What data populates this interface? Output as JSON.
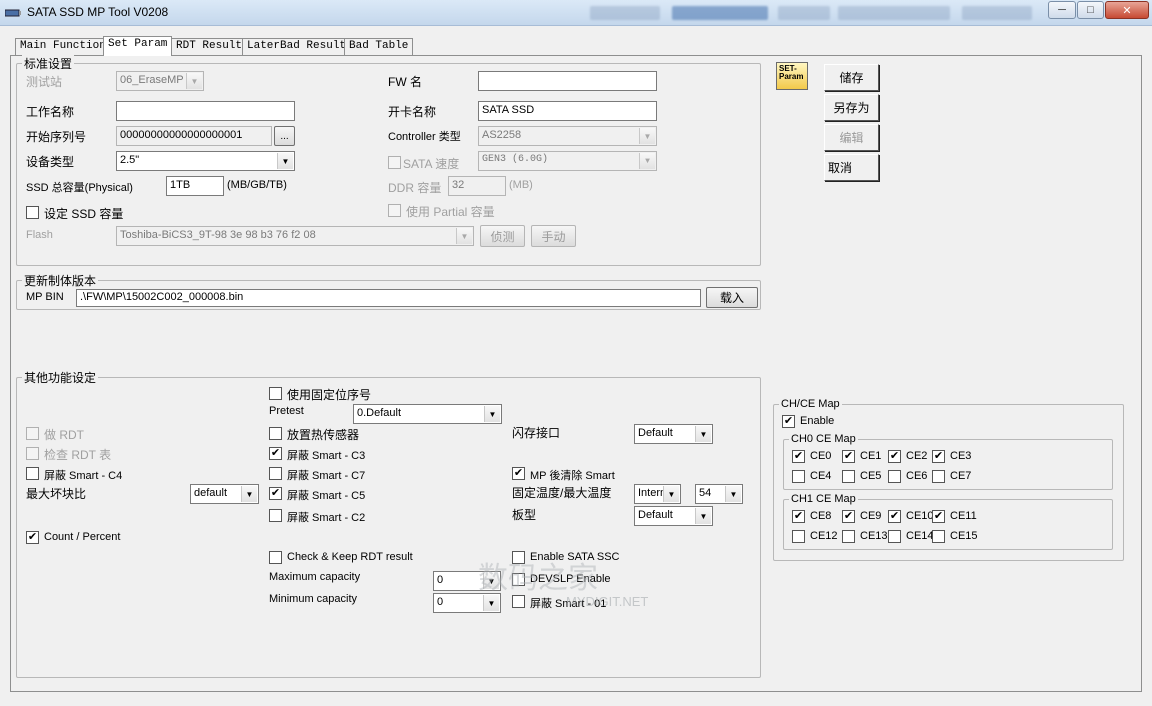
{
  "window": {
    "title": "SATA SSD MP Tool V0208",
    "controls": {
      "minimize": "─",
      "maximize": "□",
      "close": "✕"
    }
  },
  "tabs": [
    {
      "label": "Main Function"
    },
    {
      "label": "Set Param"
    },
    {
      "label": "RDT Result"
    },
    {
      "label": "LaterBad Result"
    },
    {
      "label": "Bad Table"
    }
  ],
  "standard": {
    "group_label": "标准设置",
    "station_label": "测试站",
    "station_value": "06_EraseMP",
    "work_name_label": "工作名称",
    "work_name_value": "",
    "start_serial_label": "开始序列号",
    "start_serial_value": "00000000000000000001",
    "serial_browse": "...",
    "device_type_label": "设备类型",
    "device_type_value": "2.5\"",
    "ssd_capacity_label": "SSD 总容量(Physical)",
    "ssd_capacity_value": "1TB",
    "ssd_capacity_unit": "(MB/GB/TB)",
    "set_ssd_capacity_label": "设定 SSD 容量",
    "flash_label": "Flash",
    "flash_value": "Toshiba-BiCS3_9T-98 3e 98 b3 76 f2 08",
    "detect_button": "侦测",
    "manual_button": "手动",
    "fw_name_label": "FW 名",
    "fw_name_value": "",
    "card_name_label": "开卡名称",
    "card_name_value": "SATA SSD",
    "controller_label": "Controller 类型",
    "controller_value": "AS2258",
    "sata_speed_label": "SATA 速度",
    "sata_speed_value": "GEN3 (6.0G)",
    "ddr_label": "DDR 容量",
    "ddr_value": "32",
    "ddr_unit": "(MB)",
    "partial_label": "使用 Partial 容量"
  },
  "firmware": {
    "group_label": "更新制体版本",
    "mp_bin_label": "MP BIN",
    "mp_bin_value": ".\\FW\\MP\\15002C002_000008.bin",
    "load_button": "载入"
  },
  "side_buttons": {
    "icon_text": "SET-Param",
    "save": "储存",
    "save_as": "另存为",
    "edit": "编辑",
    "cancel": "取消"
  },
  "other": {
    "group_label": "其他功能设定",
    "do_rdt": "做 RDT",
    "check_rdt_table": "检查 RDT 表",
    "mask_smart_c4": "屏蔽 Smart - C4",
    "max_bad_block_label": "最大坏块比",
    "max_bad_block_value": "default",
    "count_percent": "Count / Percent",
    "use_fixed_position": "使用固定位序号",
    "pretest_label": "Pretest",
    "pretest_value": "0.Default",
    "thermal_sensor": "放置热传感器",
    "mask_smart_c3": "屏蔽 Smart - C3",
    "mask_smart_c7": "屏蔽 Smart - C7",
    "mask_smart_c5": "屏蔽 Smart - C5",
    "mask_smart_c2": "屏蔽 Smart - C2",
    "check_keep_rdt": "Check & Keep RDT result",
    "max_capacity_label": "Maximum capacity",
    "max_capacity_value": "0",
    "min_capacity_label": "Minimum capacity",
    "min_capacity_value": "0",
    "flash_interface_label": "闪存接口",
    "flash_interface_value": "Default",
    "mp_clear_smart": "MP 後清除 Smart",
    "temp_label": "固定温度/最大温度",
    "temp_mode_value": "Intern",
    "temp_value": "54",
    "board_label": "板型",
    "board_value": "Default",
    "enable_sata_ssc": "Enable SATA SSC",
    "devslp_enable": "DEVSLP Enable",
    "mask_smart_01": "屏蔽 Smart - 01"
  },
  "chce": {
    "group_label": "CH/CE Map",
    "enable_label": "Enable",
    "ch0_label": "CH0 CE Map",
    "ch1_label": "CH1 CE Map",
    "ch0": [
      {
        "label": "CE0",
        "checked": true
      },
      {
        "label": "CE1",
        "checked": true
      },
      {
        "label": "CE2",
        "checked": true
      },
      {
        "label": "CE3",
        "checked": true
      },
      {
        "label": "CE4",
        "checked": false
      },
      {
        "label": "CE5",
        "checked": false
      },
      {
        "label": "CE6",
        "checked": false
      },
      {
        "label": "CE7",
        "checked": false
      }
    ],
    "ch1": [
      {
        "label": "CE8",
        "checked": true
      },
      {
        "label": "CE9",
        "checked": true
      },
      {
        "label": "CE10",
        "checked": true
      },
      {
        "label": "CE11",
        "checked": true
      },
      {
        "label": "CE12",
        "checked": false
      },
      {
        "label": "CE13",
        "checked": false
      },
      {
        "label": "CE14",
        "checked": false
      },
      {
        "label": "CE15",
        "checked": false
      }
    ]
  },
  "watermark": {
    "text": "数码之家",
    "sub": "MYDIGIT.NET"
  },
  "icons": {
    "combo_arrow": "▼",
    "check_mark": "✔"
  }
}
